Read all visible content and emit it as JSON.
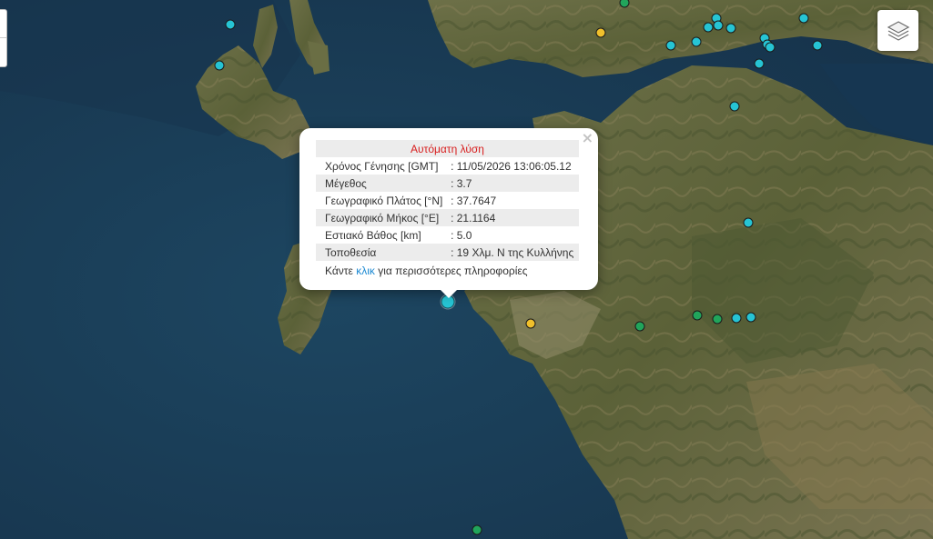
{
  "popup": {
    "title": "Αυτόματη λύση",
    "rows": [
      {
        "label": "Χρόνος Γένησης [GMT]",
        "value": ": 11/05/2026 13:06:05.12"
      },
      {
        "label": "Μέγεθος",
        "value": ": 3.7"
      },
      {
        "label": "Γεωγραφικό Πλάτος [°N]",
        "value": ": 37.7647"
      },
      {
        "label": "Γεωγραφικό Μήκος [°E]",
        "value": ": 21.1164"
      },
      {
        "label": "Εστιακό Βάθος [km]",
        "value": ": 5.0"
      },
      {
        "label": "Τοποθεσία",
        "value": ": 19 Χλμ. Ν της Κυλλήνης"
      }
    ],
    "more_prefix": "Κάντε ",
    "more_link": "κλικ",
    "more_suffix": " για περισσότερες πληροφορίες",
    "close_symbol": "×"
  },
  "legend_colors": {
    "cyan": "#26c4d4",
    "green": "#21a55b",
    "yellow": "#f0c02c",
    "title_red": "#d81e1e",
    "link_blue": "#1d8ad3"
  },
  "controls": {
    "layers_icon": "layers-icon",
    "zoom_control": "zoom-control"
  }
}
